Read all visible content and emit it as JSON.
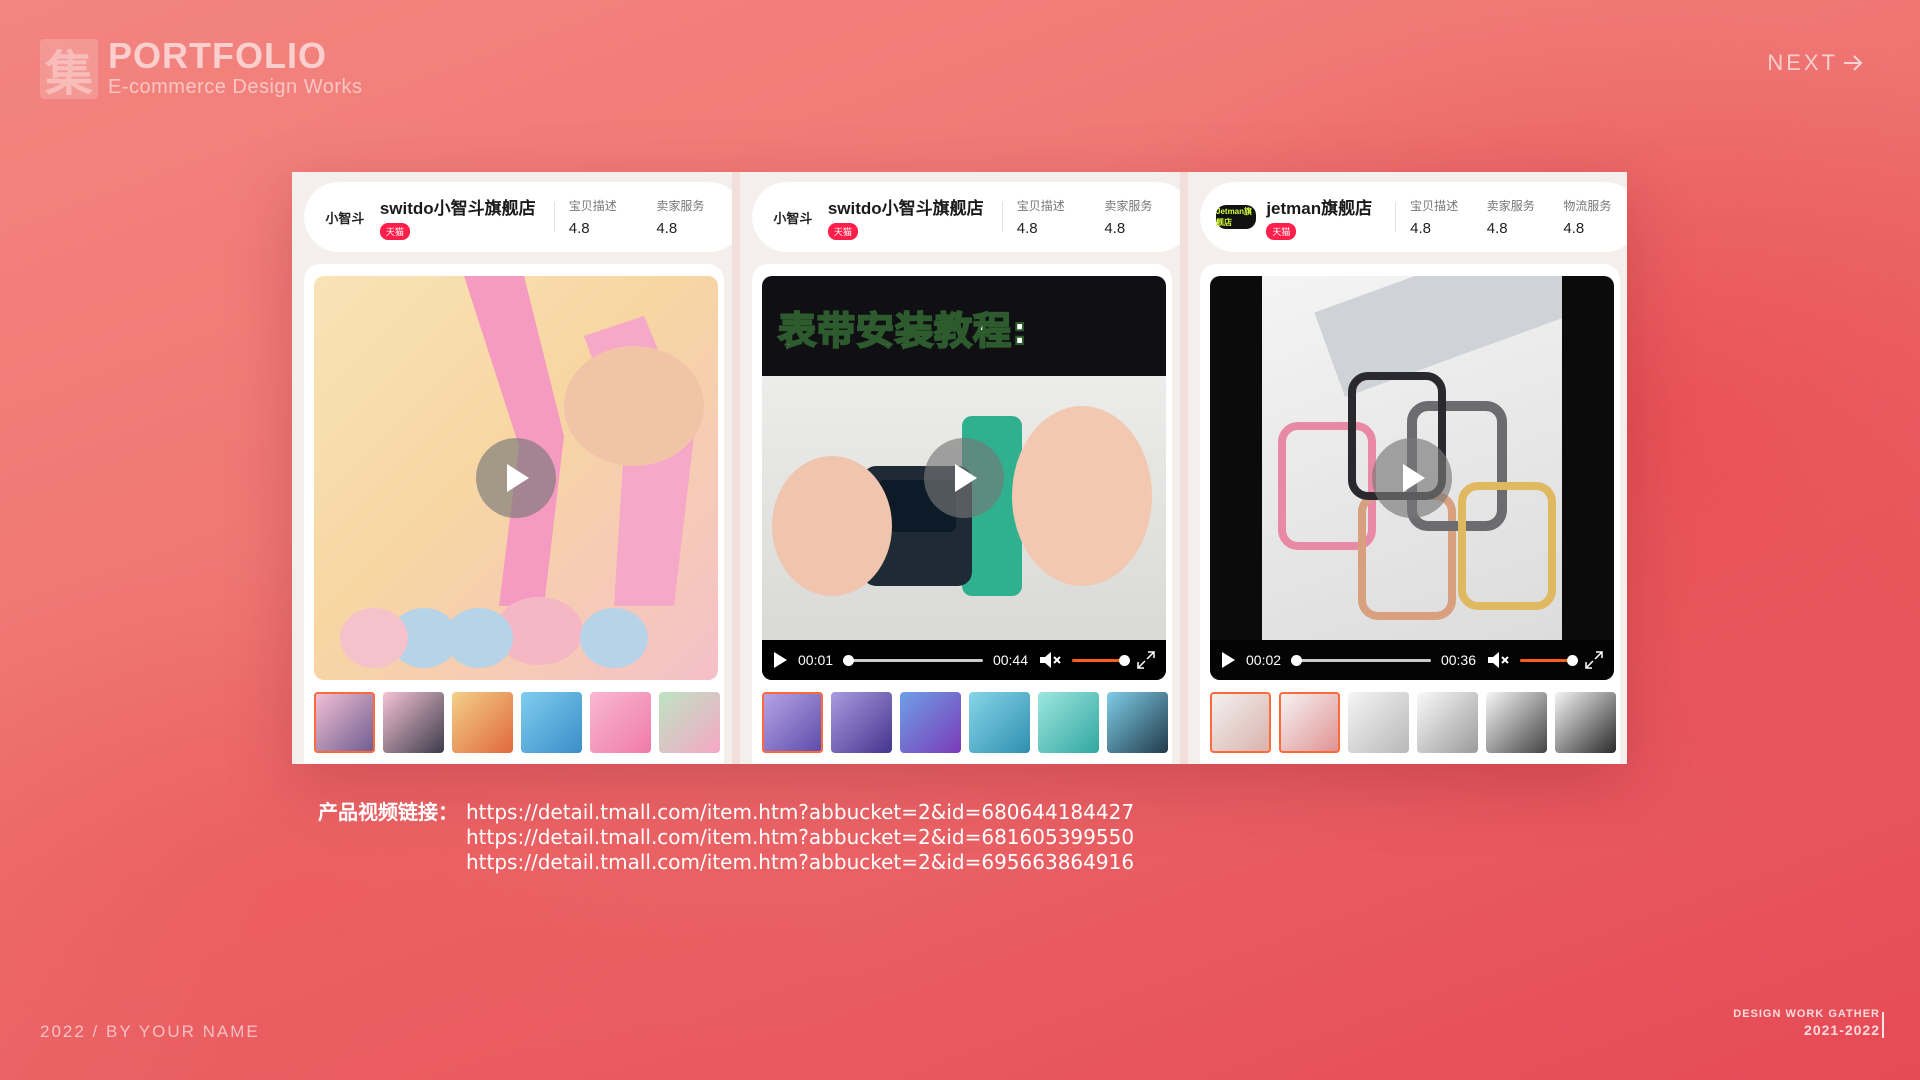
{
  "header": {
    "mark": "集",
    "title": "PORTFOLIO",
    "subtitle": "E-commerce Design Works",
    "next_label": "NEXT"
  },
  "panels": [
    {
      "shop_logo": "小智斗",
      "shop_name": "switdo小智斗旗舰店",
      "badge": "天猫",
      "stats": [
        {
          "label": "宝贝描述",
          "value": "4.8"
        },
        {
          "label": "卖家服务",
          "value": "4.8"
        }
      ],
      "video": {
        "has_controls": false
      }
    },
    {
      "shop_logo": "小智斗",
      "shop_name": "switdo小智斗旗舰店",
      "badge": "天猫",
      "stats": [
        {
          "label": "宝贝描述",
          "value": "4.8"
        },
        {
          "label": "卖家服务",
          "value": "4.8"
        }
      ],
      "video": {
        "title_overlay": "表带安装教程:",
        "current_time": "00:01",
        "duration": "00:44"
      }
    },
    {
      "shop_logo": "Jetman旗舰店",
      "shop_name": "jetman旗舰店",
      "badge": "天猫",
      "stats": [
        {
          "label": "宝贝描述",
          "value": "4.8"
        },
        {
          "label": "卖家服务",
          "value": "4.8"
        },
        {
          "label": "物流服务",
          "value": "4.8"
        }
      ],
      "video": {
        "current_time": "00:02",
        "duration": "00:36"
      }
    }
  ],
  "links": {
    "label": "产品视频链接：",
    "urls": [
      "https://detail.tmall.com/item.htm?abbucket=2&id=680644184427",
      "https://detail.tmall.com/item.htm?abbucket=2&id=681605399550",
      "https://detail.tmall.com/item.htm?abbucket=2&id=695663864916"
    ]
  },
  "footer": {
    "left": "2022 / BY YOUR NAME",
    "right_line1": "DESIGN WORK GATHER",
    "right_line2": "2021-2022"
  },
  "colors": {
    "accent": "#ff5a1f",
    "tmall_badge": "#ff1f4a",
    "background": "#ef7673"
  }
}
